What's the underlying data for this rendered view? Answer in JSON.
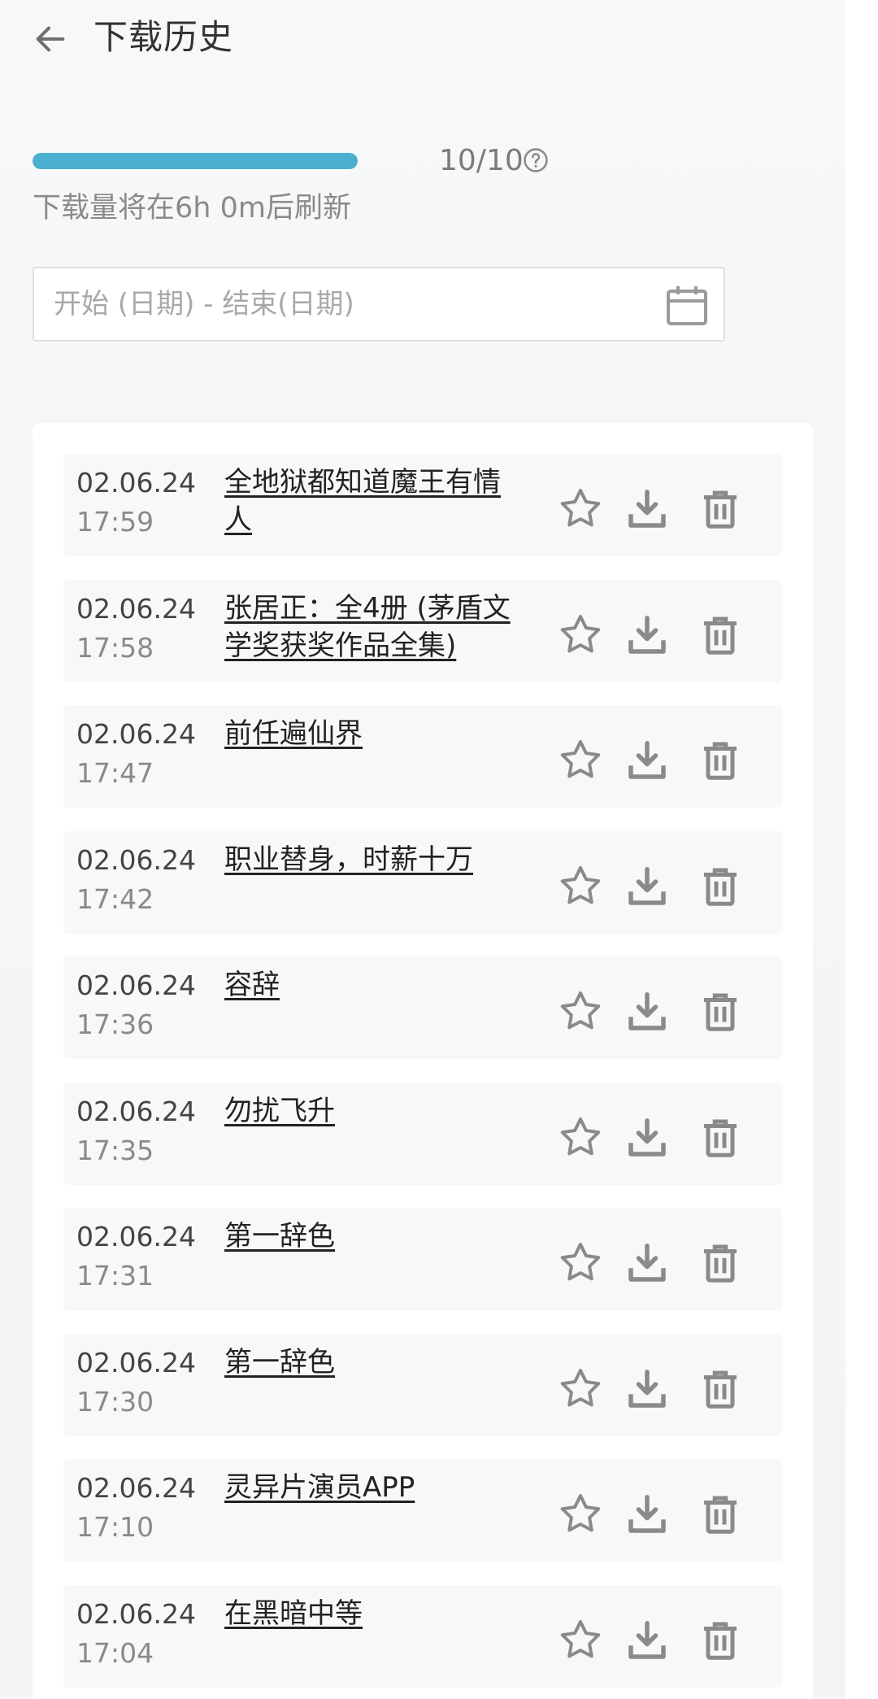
{
  "header": {
    "title": "下载历史",
    "back_icon": "arrow-left-icon"
  },
  "quota": {
    "used": 10,
    "total": 10,
    "label": "10/10",
    "refresh_note": "下载量将在6h 0m后刷新",
    "progress_fraction": 1.0
  },
  "date_range": {
    "placeholder": "开始 (日期) - 结束(日期)",
    "icon": "calendar-icon"
  },
  "colors": {
    "progress": "#4bb0cf",
    "icon_gray": "#8a8a8a"
  },
  "history": [
    {
      "date": "02.06.24",
      "time": "17:59",
      "title": "全地狱都知道魔王有情人"
    },
    {
      "date": "02.06.24",
      "time": "17:58",
      "title": "张居正：全4册 (茅盾文学奖获奖作品全集)"
    },
    {
      "date": "02.06.24",
      "time": "17:47",
      "title": "前任遍仙界"
    },
    {
      "date": "02.06.24",
      "time": "17:42",
      "title": "职业替身，时薪十万"
    },
    {
      "date": "02.06.24",
      "time": "17:36",
      "title": "容辞"
    },
    {
      "date": "02.06.24",
      "time": "17:35",
      "title": "勿扰飞升"
    },
    {
      "date": "02.06.24",
      "time": "17:31",
      "title": "第一辞色"
    },
    {
      "date": "02.06.24",
      "time": "17:30",
      "title": "第一辞色"
    },
    {
      "date": "02.06.24",
      "time": "17:10",
      "title": "灵异片演员APP"
    },
    {
      "date": "02.06.24",
      "time": "17:04",
      "title": "在黑暗中等"
    }
  ]
}
